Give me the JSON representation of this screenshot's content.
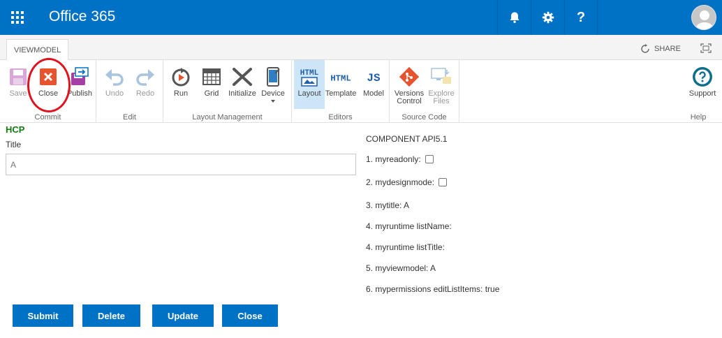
{
  "suitebar": {
    "brand": "Office 365",
    "help_label": "?",
    "color": "#0072c6"
  },
  "tabs": {
    "active": "VIEWMODEL",
    "share": "SHARE"
  },
  "ribbon": {
    "groups": {
      "commit": "Commit",
      "edit": "Edit",
      "layout": "Layout Management",
      "editors": "Editors",
      "source": "Source Code",
      "help": "Help"
    },
    "buttons": {
      "save": "Save",
      "close": "Close",
      "publish": "Publish",
      "undo": "Undo",
      "redo": "Redo",
      "run": "Run",
      "grid": "Grid",
      "initialize": "Initialize",
      "device": "Device",
      "layout": "Layout",
      "template": "Template",
      "model": "Model",
      "versions_line1": "Versions",
      "versions_line2": "Control",
      "explore_line1": "Explore",
      "explore_line2": "Files",
      "support": "Support"
    },
    "icon_text": {
      "html": "HTML",
      "js": "JS"
    }
  },
  "form": {
    "section_title": "HCP",
    "title_label": "Title",
    "title_value": "A"
  },
  "api": {
    "heading": "COMPONENT API5.1",
    "lines": [
      "1. myreadonly:",
      "2. mydesignmode:",
      "3. mytitle: A",
      "4. myruntime listName:",
      "4. myruntime listTitle:",
      "5. myviewmodel: A",
      "6. mypermissions editListItems: true"
    ]
  },
  "actions": {
    "submit": "Submit",
    "delete": "Delete",
    "update": "Update",
    "close": "Close"
  },
  "colors": {
    "accent": "#0072c6",
    "green": "#107c10",
    "highlight": "#e0121e"
  }
}
